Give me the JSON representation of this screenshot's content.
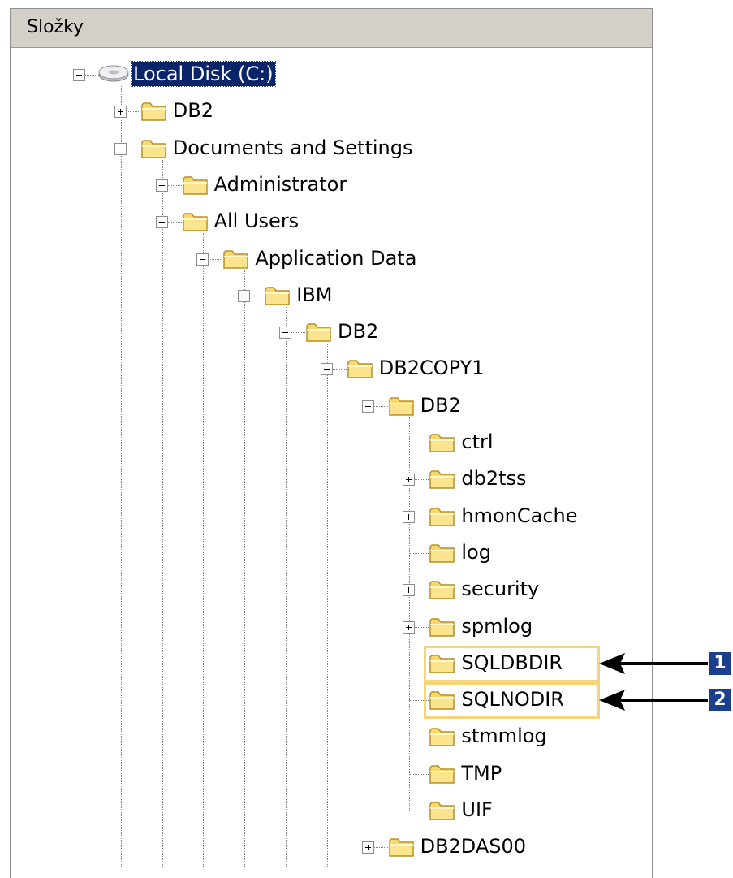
{
  "panel": {
    "title": "Složky"
  },
  "tree": [
    {
      "id": "root",
      "label": "Local Disk (C:)",
      "depth": 0,
      "expander": "minus",
      "icon": "drive-icon",
      "selected": true,
      "row": 0
    },
    {
      "id": "db2",
      "label": "DB2",
      "depth": 1,
      "expander": "plus",
      "icon": "folder-icon",
      "row": 1
    },
    {
      "id": "docs",
      "label": "Documents and Settings",
      "depth": 1,
      "expander": "minus",
      "icon": "folder-icon",
      "row": 2
    },
    {
      "id": "admin",
      "label": "Administrator",
      "depth": 2,
      "expander": "plus",
      "icon": "folder-icon",
      "row": 3
    },
    {
      "id": "allusers",
      "label": "All Users",
      "depth": 2,
      "expander": "minus",
      "icon": "folder-icon",
      "row": 4
    },
    {
      "id": "appdata",
      "label": "Application Data",
      "depth": 3,
      "expander": "minus",
      "icon": "folder-icon",
      "row": 5
    },
    {
      "id": "ibm",
      "label": "IBM",
      "depth": 4,
      "expander": "minus",
      "icon": "folder-icon",
      "row": 6
    },
    {
      "id": "ibm-db2",
      "label": "DB2",
      "depth": 5,
      "expander": "minus",
      "icon": "folder-icon",
      "row": 7
    },
    {
      "id": "db2copy1",
      "label": "DB2COPY1",
      "depth": 6,
      "expander": "minus",
      "icon": "folder-icon",
      "row": 8
    },
    {
      "id": "copy-db2",
      "label": "DB2",
      "depth": 7,
      "expander": "minus",
      "icon": "folder-icon",
      "row": 9
    },
    {
      "id": "ctrl",
      "label": "ctrl",
      "depth": 8,
      "expander": "none",
      "icon": "folder-icon",
      "row": 10
    },
    {
      "id": "db2tss",
      "label": "db2tss",
      "depth": 8,
      "expander": "plus",
      "icon": "folder-icon",
      "row": 11
    },
    {
      "id": "hmoncache",
      "label": "hmonCache",
      "depth": 8,
      "expander": "plus",
      "icon": "folder-icon",
      "row": 12
    },
    {
      "id": "log",
      "label": "log",
      "depth": 8,
      "expander": "none",
      "icon": "folder-icon",
      "row": 13
    },
    {
      "id": "security",
      "label": "security",
      "depth": 8,
      "expander": "plus",
      "icon": "folder-icon",
      "row": 14
    },
    {
      "id": "spmlog",
      "label": "spmlog",
      "depth": 8,
      "expander": "plus",
      "icon": "folder-icon",
      "row": 15
    },
    {
      "id": "sqldbdir",
      "label": "SQLDBDIR",
      "depth": 8,
      "expander": "none",
      "icon": "folder-icon",
      "row": 16,
      "callout": "1"
    },
    {
      "id": "sqlnodir",
      "label": "SQLNODIR",
      "depth": 8,
      "expander": "none",
      "icon": "folder-icon",
      "row": 17,
      "callout": "2"
    },
    {
      "id": "stmmlog",
      "label": "stmmlog",
      "depth": 8,
      "expander": "none",
      "icon": "folder-icon",
      "row": 18
    },
    {
      "id": "tmp",
      "label": "TMP",
      "depth": 8,
      "expander": "none",
      "icon": "folder-icon",
      "row": 19
    },
    {
      "id": "uif",
      "label": "UIF",
      "depth": 8,
      "expander": "none",
      "icon": "folder-icon",
      "row": 20
    },
    {
      "id": "db2das00",
      "label": "DB2DAS00",
      "depth": 7,
      "expander": "plus",
      "icon": "folder-icon",
      "row": 21
    }
  ],
  "colors": {
    "selection": "#0a246a",
    "highlight_box": "#f6d47a",
    "callout": "#1b3f8c",
    "folder_fill": "#f7d86a",
    "folder_stroke": "#b8902a"
  }
}
